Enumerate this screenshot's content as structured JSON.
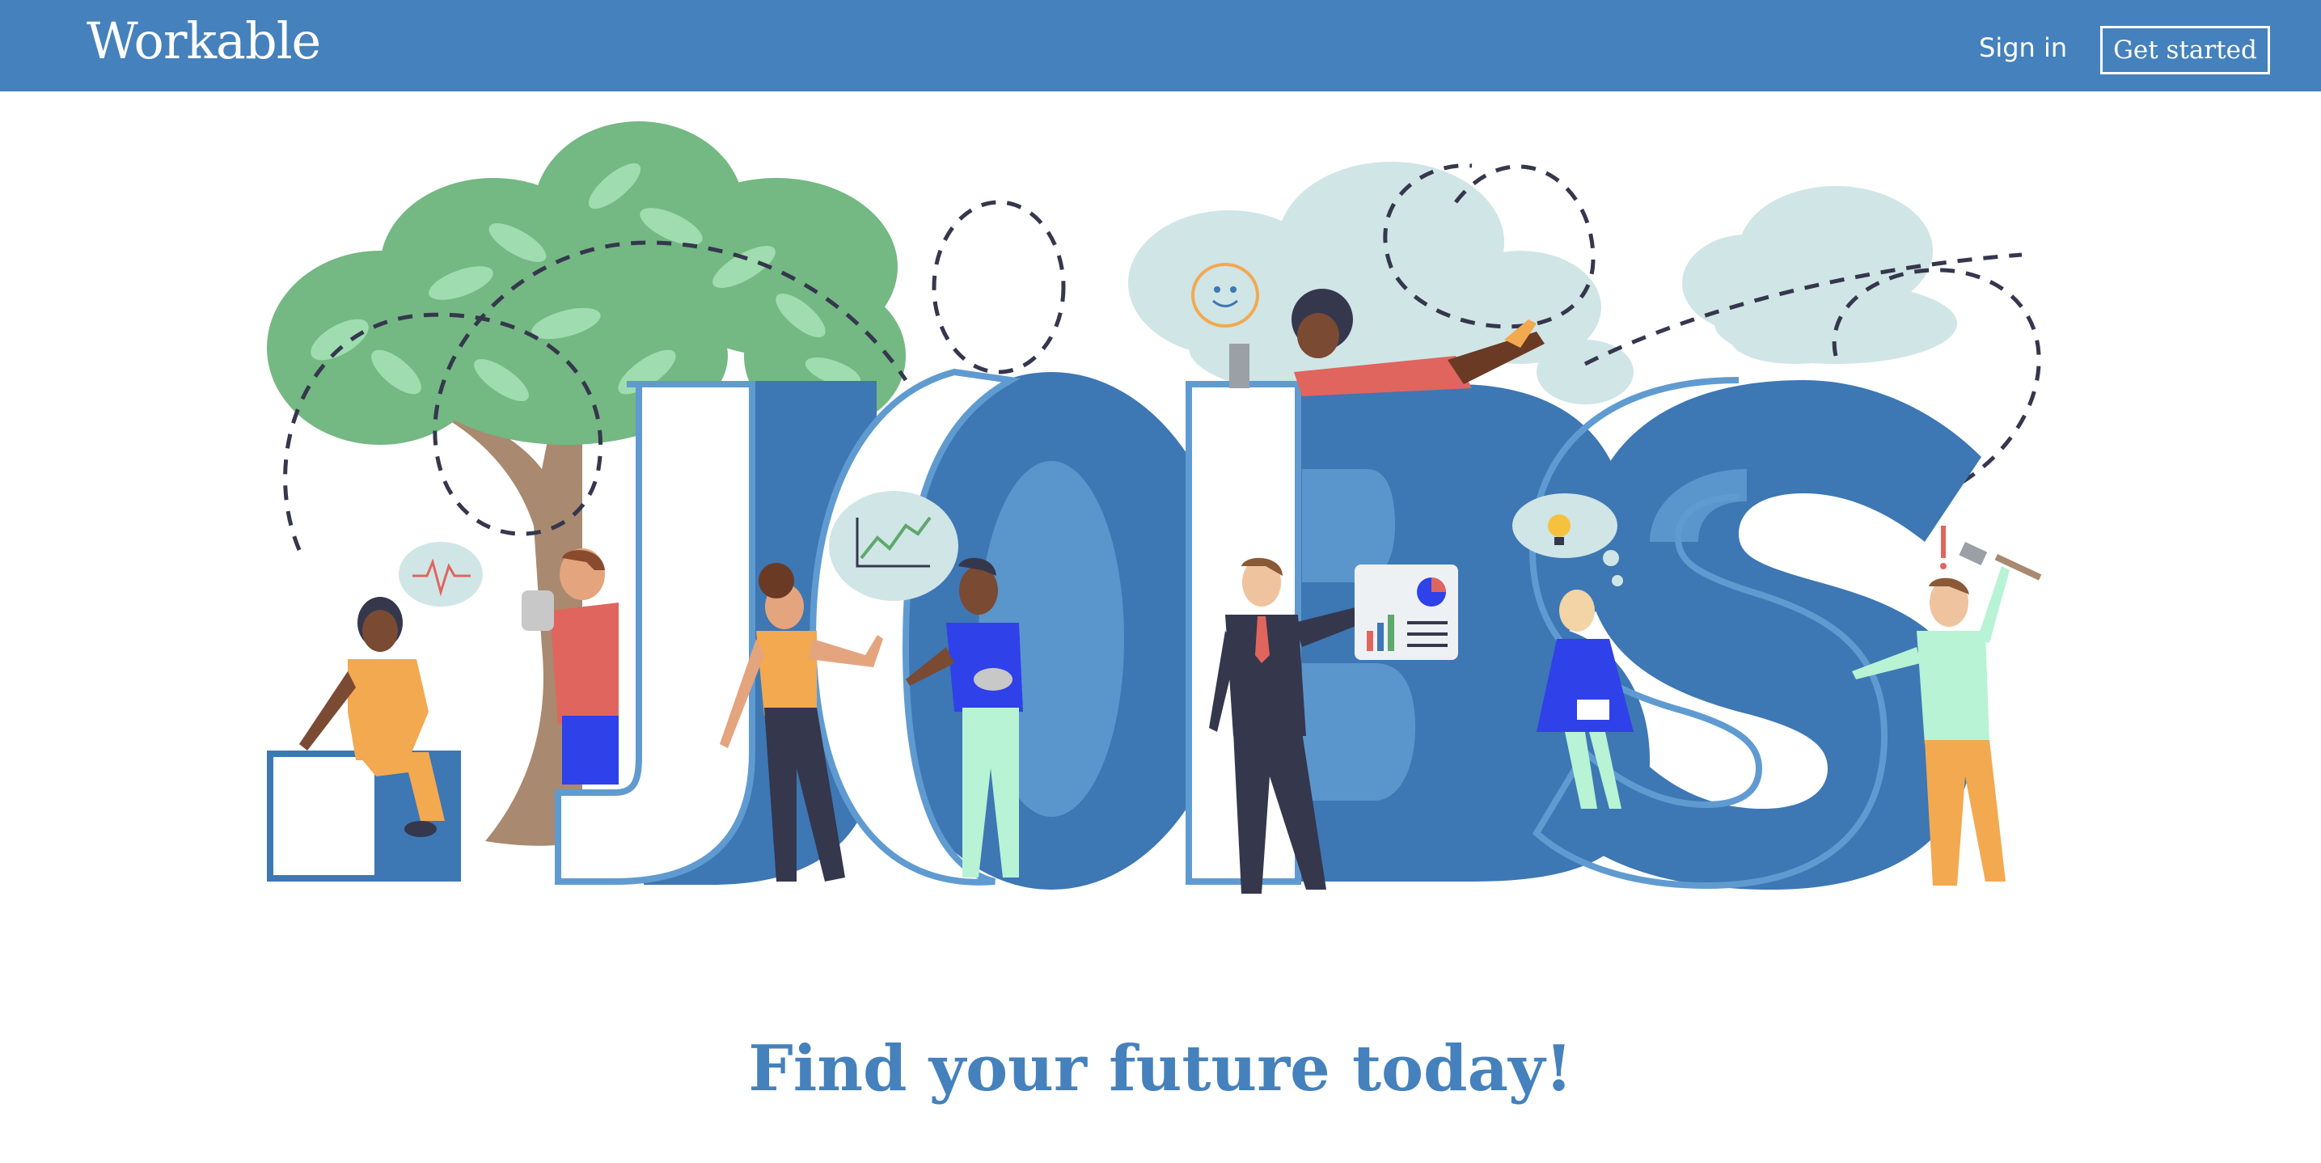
{
  "header": {
    "logo": "Workable",
    "signin_label": "Sign in",
    "cta_label": "Get started"
  },
  "hero": {
    "word": "JOBS",
    "illustration_icons": [
      "tree-icon",
      "cloud-icon",
      "heartbeat-icon",
      "chart-icon",
      "smiley-icon",
      "lightbulb-icon",
      "laptop-icon",
      "presentation-icon",
      "hammer-icon"
    ]
  },
  "tagline": "Find your future today!",
  "colors": {
    "brand": "#4581bc",
    "letter_dark": "#3d77b4",
    "tree": "#74b883",
    "cloud": "#d0e5e6"
  }
}
